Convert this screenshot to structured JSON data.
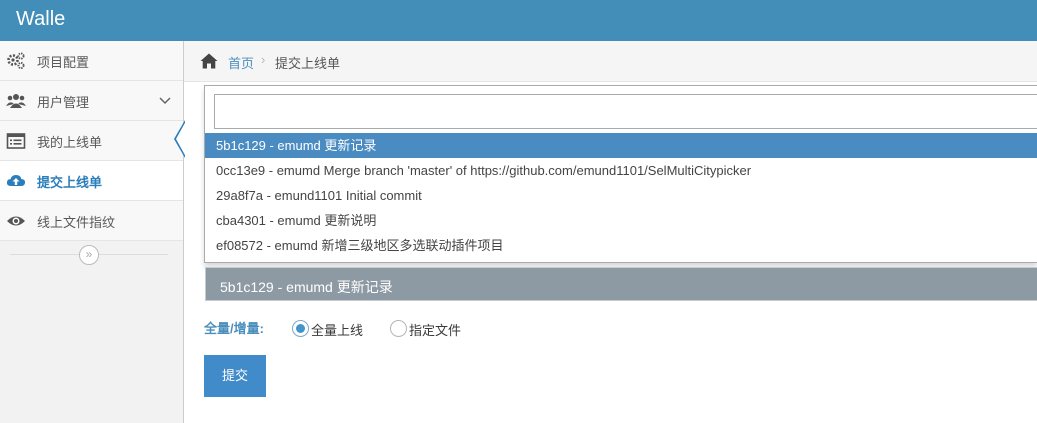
{
  "app": {
    "title": "Walle"
  },
  "sidebar": {
    "items": [
      {
        "label": "项目配置",
        "icon": "gears-icon"
      },
      {
        "label": "用户管理",
        "icon": "users-icon"
      },
      {
        "label": "我的上线单",
        "icon": "list-icon"
      },
      {
        "label": "提交上线单",
        "icon": "cloud-upload-icon"
      },
      {
        "label": "线上文件指纹",
        "icon": "eye-icon"
      }
    ],
    "collapse_glyph": "»"
  },
  "breadcrumb": {
    "home": "首页",
    "separator": "›",
    "current": "提交上线单"
  },
  "commit_select": {
    "search_value": "",
    "options": [
      "5b1c129 - emumd 更新记录",
      "0cc13e9 - emumd Merge branch 'master' of https://github.com/emund1101/SelMultiCitypicker",
      "29a8f7a - emund1101 Initial commit",
      "cba4301 - emumd 更新说明",
      "ef08572 - emumd 新增三级地区多选联动插件项目"
    ],
    "selected": "5b1c129 - emumd 更新记录"
  },
  "deploy_mode": {
    "label": "全量/增量:",
    "options": [
      {
        "label": "全量上线",
        "checked": true
      },
      {
        "label": "指定文件",
        "checked": false
      }
    ]
  },
  "submit": {
    "label": "提交"
  },
  "colors": {
    "header": "#438eb9",
    "accent": "#2b7dbc",
    "highlight": "#4a8bc2",
    "button": "#428bca"
  }
}
